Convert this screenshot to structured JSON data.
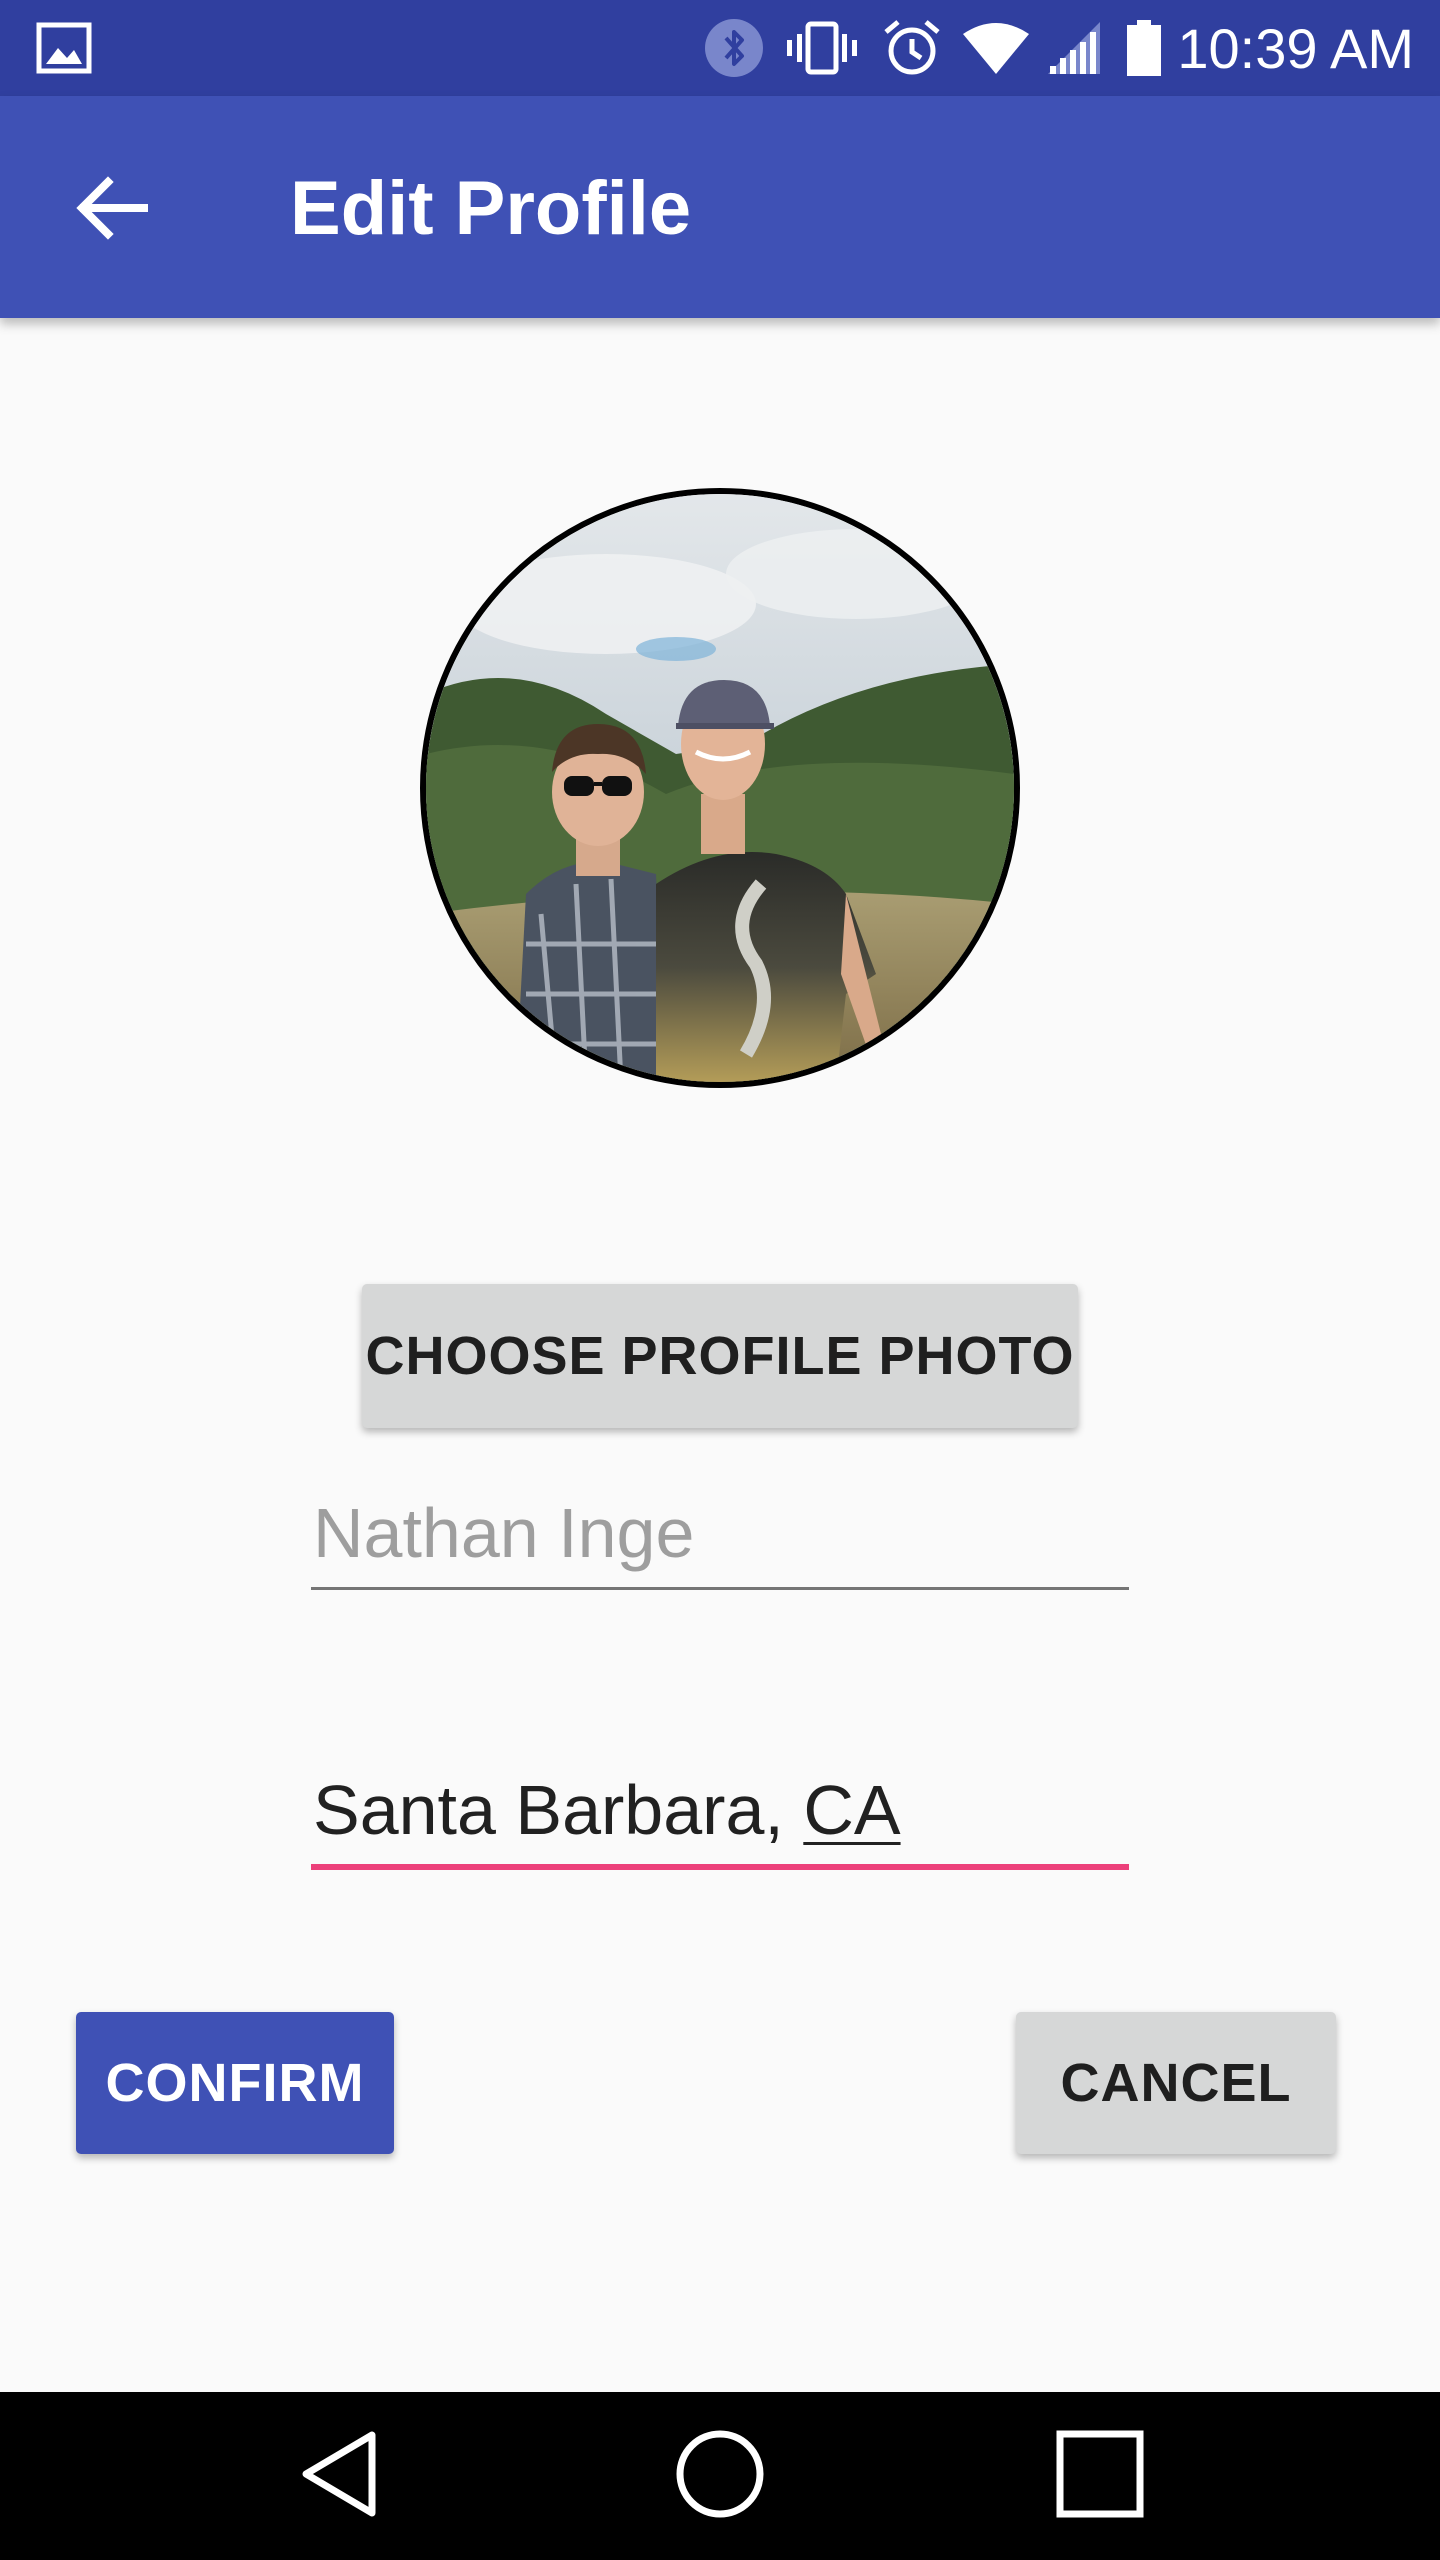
{
  "status_bar": {
    "time": "10:39 AM",
    "icons": [
      "gallery-icon",
      "bluetooth-icon",
      "vibrate-icon",
      "alarm-icon",
      "wifi-icon",
      "signal-icon",
      "battery-icon"
    ],
    "background": "#303f9f"
  },
  "app_bar": {
    "title": "Edit Profile",
    "back_icon": "arrow-back-icon",
    "background": "#3f51b5"
  },
  "profile": {
    "photo_icon": "profile-photo",
    "choose_photo_label": "CHOOSE PROFILE PHOTO",
    "name_hint": "Nathan Inge",
    "location_prefix": "Santa Barbara, ",
    "location_composing": "CA"
  },
  "actions": {
    "confirm_label": "CONFIRM",
    "cancel_label": "CANCEL"
  },
  "colors": {
    "primary": "#3f51b5",
    "primary_dark": "#303f9f",
    "accent": "#ec407a",
    "button_grey": "#d6d7d7"
  },
  "nav_bar": {
    "icons": [
      "back-triangle-icon",
      "home-circle-icon",
      "recents-square-icon"
    ]
  }
}
